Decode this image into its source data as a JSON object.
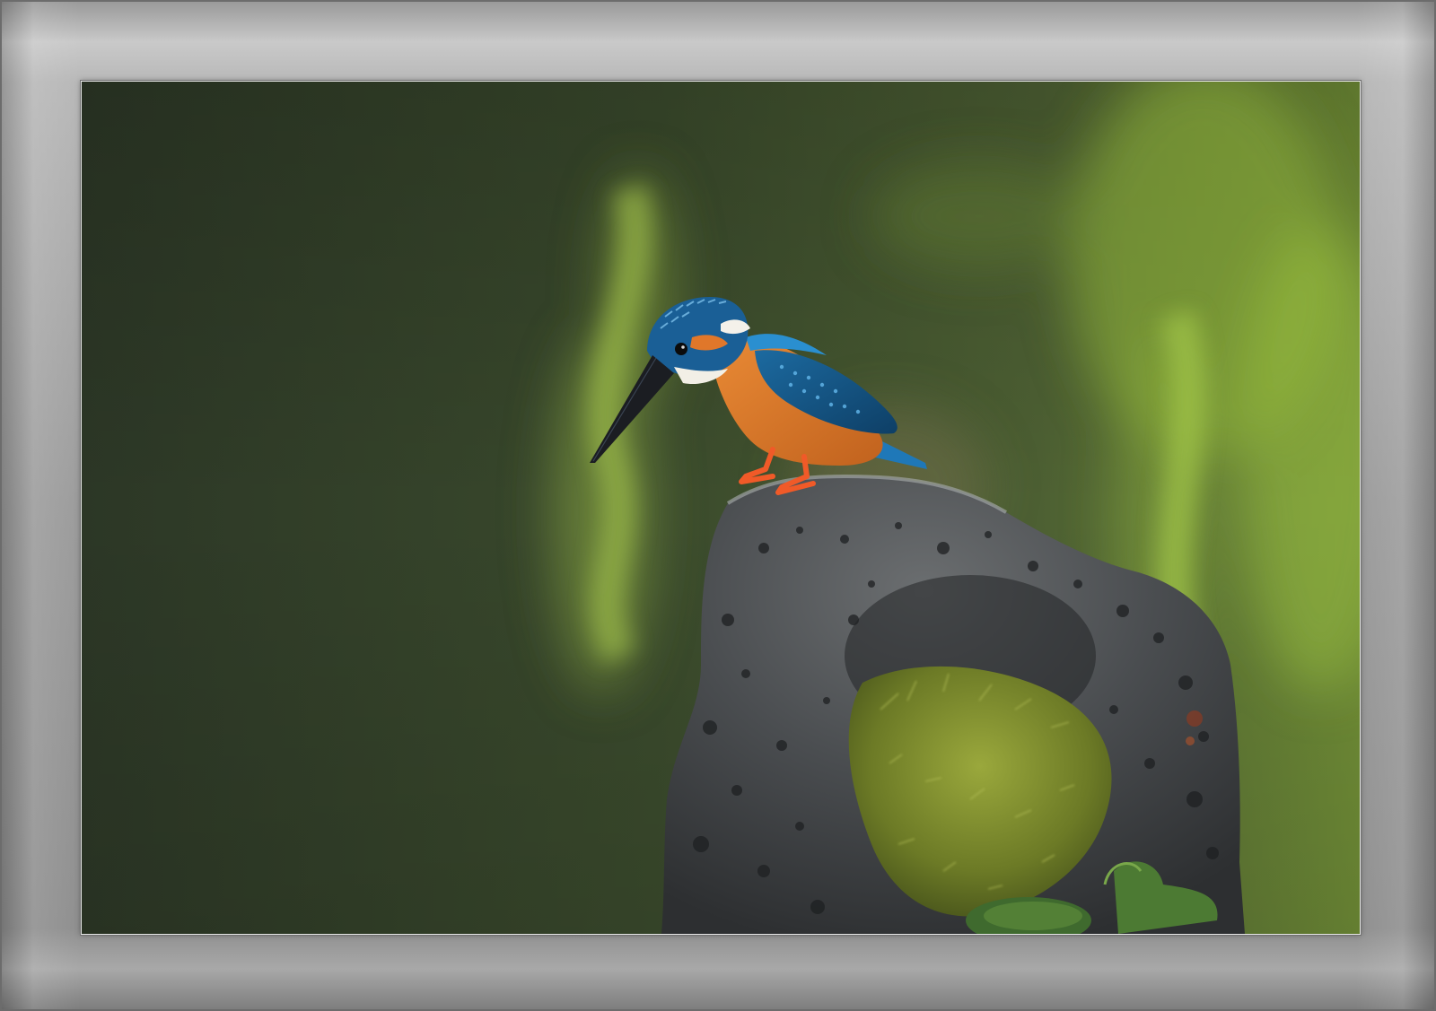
{
  "frame": {
    "color": "#a3a3a3"
  },
  "photo": {
    "background_colors": [
      "#2f3b28",
      "#4a5a33",
      "#7fa03b"
    ],
    "bird_colors": {
      "crown": "#1e6fa8",
      "breast": "#d9782a",
      "throat": "#f2efe6",
      "legs": "#f05a28"
    },
    "rock_color": "#4a4d50",
    "moss_color": "#6f7f2a"
  }
}
